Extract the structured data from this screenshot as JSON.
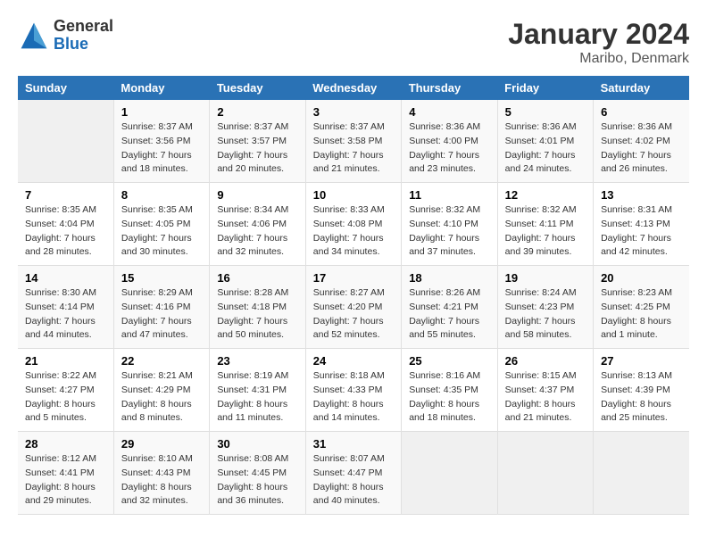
{
  "logo": {
    "general": "General",
    "blue": "Blue"
  },
  "title": "January 2024",
  "location": "Maribo, Denmark",
  "days_header": [
    "Sunday",
    "Monday",
    "Tuesday",
    "Wednesday",
    "Thursday",
    "Friday",
    "Saturday"
  ],
  "weeks": [
    [
      {
        "day": "",
        "sunrise": "",
        "sunset": "",
        "daylight": "",
        "empty": true
      },
      {
        "day": "1",
        "sunrise": "Sunrise: 8:37 AM",
        "sunset": "Sunset: 3:56 PM",
        "daylight": "Daylight: 7 hours and 18 minutes."
      },
      {
        "day": "2",
        "sunrise": "Sunrise: 8:37 AM",
        "sunset": "Sunset: 3:57 PM",
        "daylight": "Daylight: 7 hours and 20 minutes."
      },
      {
        "day": "3",
        "sunrise": "Sunrise: 8:37 AM",
        "sunset": "Sunset: 3:58 PM",
        "daylight": "Daylight: 7 hours and 21 minutes."
      },
      {
        "day": "4",
        "sunrise": "Sunrise: 8:36 AM",
        "sunset": "Sunset: 4:00 PM",
        "daylight": "Daylight: 7 hours and 23 minutes."
      },
      {
        "day": "5",
        "sunrise": "Sunrise: 8:36 AM",
        "sunset": "Sunset: 4:01 PM",
        "daylight": "Daylight: 7 hours and 24 minutes."
      },
      {
        "day": "6",
        "sunrise": "Sunrise: 8:36 AM",
        "sunset": "Sunset: 4:02 PM",
        "daylight": "Daylight: 7 hours and 26 minutes."
      }
    ],
    [
      {
        "day": "7",
        "sunrise": "Sunrise: 8:35 AM",
        "sunset": "Sunset: 4:04 PM",
        "daylight": "Daylight: 7 hours and 28 minutes."
      },
      {
        "day": "8",
        "sunrise": "Sunrise: 8:35 AM",
        "sunset": "Sunset: 4:05 PM",
        "daylight": "Daylight: 7 hours and 30 minutes."
      },
      {
        "day": "9",
        "sunrise": "Sunrise: 8:34 AM",
        "sunset": "Sunset: 4:06 PM",
        "daylight": "Daylight: 7 hours and 32 minutes."
      },
      {
        "day": "10",
        "sunrise": "Sunrise: 8:33 AM",
        "sunset": "Sunset: 4:08 PM",
        "daylight": "Daylight: 7 hours and 34 minutes."
      },
      {
        "day": "11",
        "sunrise": "Sunrise: 8:32 AM",
        "sunset": "Sunset: 4:10 PM",
        "daylight": "Daylight: 7 hours and 37 minutes."
      },
      {
        "day": "12",
        "sunrise": "Sunrise: 8:32 AM",
        "sunset": "Sunset: 4:11 PM",
        "daylight": "Daylight: 7 hours and 39 minutes."
      },
      {
        "day": "13",
        "sunrise": "Sunrise: 8:31 AM",
        "sunset": "Sunset: 4:13 PM",
        "daylight": "Daylight: 7 hours and 42 minutes."
      }
    ],
    [
      {
        "day": "14",
        "sunrise": "Sunrise: 8:30 AM",
        "sunset": "Sunset: 4:14 PM",
        "daylight": "Daylight: 7 hours and 44 minutes."
      },
      {
        "day": "15",
        "sunrise": "Sunrise: 8:29 AM",
        "sunset": "Sunset: 4:16 PM",
        "daylight": "Daylight: 7 hours and 47 minutes."
      },
      {
        "day": "16",
        "sunrise": "Sunrise: 8:28 AM",
        "sunset": "Sunset: 4:18 PM",
        "daylight": "Daylight: 7 hours and 50 minutes."
      },
      {
        "day": "17",
        "sunrise": "Sunrise: 8:27 AM",
        "sunset": "Sunset: 4:20 PM",
        "daylight": "Daylight: 7 hours and 52 minutes."
      },
      {
        "day": "18",
        "sunrise": "Sunrise: 8:26 AM",
        "sunset": "Sunset: 4:21 PM",
        "daylight": "Daylight: 7 hours and 55 minutes."
      },
      {
        "day": "19",
        "sunrise": "Sunrise: 8:24 AM",
        "sunset": "Sunset: 4:23 PM",
        "daylight": "Daylight: 7 hours and 58 minutes."
      },
      {
        "day": "20",
        "sunrise": "Sunrise: 8:23 AM",
        "sunset": "Sunset: 4:25 PM",
        "daylight": "Daylight: 8 hours and 1 minute."
      }
    ],
    [
      {
        "day": "21",
        "sunrise": "Sunrise: 8:22 AM",
        "sunset": "Sunset: 4:27 PM",
        "daylight": "Daylight: 8 hours and 5 minutes."
      },
      {
        "day": "22",
        "sunrise": "Sunrise: 8:21 AM",
        "sunset": "Sunset: 4:29 PM",
        "daylight": "Daylight: 8 hours and 8 minutes."
      },
      {
        "day": "23",
        "sunrise": "Sunrise: 8:19 AM",
        "sunset": "Sunset: 4:31 PM",
        "daylight": "Daylight: 8 hours and 11 minutes."
      },
      {
        "day": "24",
        "sunrise": "Sunrise: 8:18 AM",
        "sunset": "Sunset: 4:33 PM",
        "daylight": "Daylight: 8 hours and 14 minutes."
      },
      {
        "day": "25",
        "sunrise": "Sunrise: 8:16 AM",
        "sunset": "Sunset: 4:35 PM",
        "daylight": "Daylight: 8 hours and 18 minutes."
      },
      {
        "day": "26",
        "sunrise": "Sunrise: 8:15 AM",
        "sunset": "Sunset: 4:37 PM",
        "daylight": "Daylight: 8 hours and 21 minutes."
      },
      {
        "day": "27",
        "sunrise": "Sunrise: 8:13 AM",
        "sunset": "Sunset: 4:39 PM",
        "daylight": "Daylight: 8 hours and 25 minutes."
      }
    ],
    [
      {
        "day": "28",
        "sunrise": "Sunrise: 8:12 AM",
        "sunset": "Sunset: 4:41 PM",
        "daylight": "Daylight: 8 hours and 29 minutes."
      },
      {
        "day": "29",
        "sunrise": "Sunrise: 8:10 AM",
        "sunset": "Sunset: 4:43 PM",
        "daylight": "Daylight: 8 hours and 32 minutes."
      },
      {
        "day": "30",
        "sunrise": "Sunrise: 8:08 AM",
        "sunset": "Sunset: 4:45 PM",
        "daylight": "Daylight: 8 hours and 36 minutes."
      },
      {
        "day": "31",
        "sunrise": "Sunrise: 8:07 AM",
        "sunset": "Sunset: 4:47 PM",
        "daylight": "Daylight: 8 hours and 40 minutes."
      },
      {
        "day": "",
        "sunrise": "",
        "sunset": "",
        "daylight": "",
        "empty": true
      },
      {
        "day": "",
        "sunrise": "",
        "sunset": "",
        "daylight": "",
        "empty": true
      },
      {
        "day": "",
        "sunrise": "",
        "sunset": "",
        "daylight": "",
        "empty": true
      }
    ]
  ]
}
